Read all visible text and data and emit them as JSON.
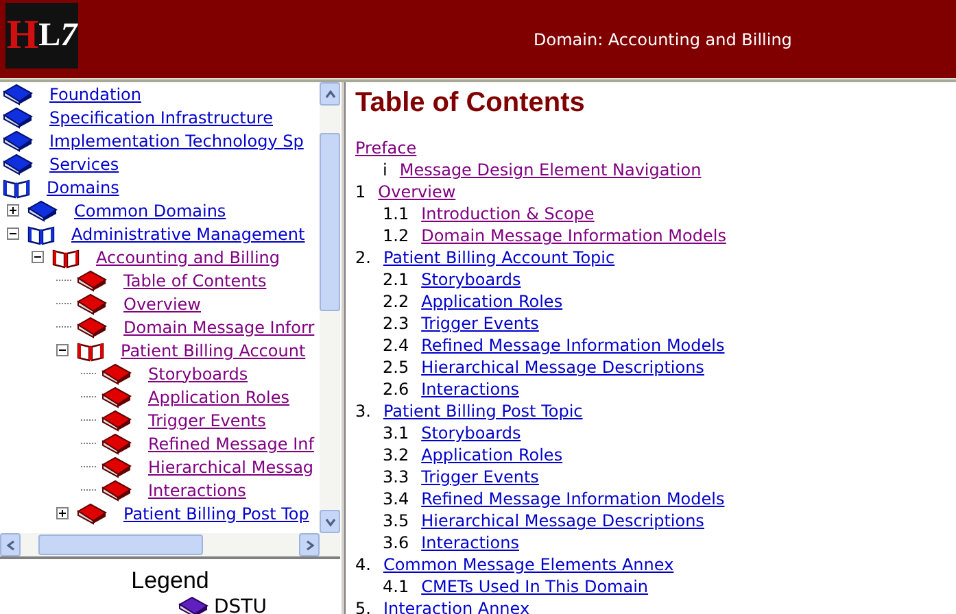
{
  "header": {
    "logo": "HL7",
    "title": "Domain: Accounting and Billing"
  },
  "tree": [
    {
      "label": "Foundation",
      "kind": "blue",
      "expanded": false,
      "visited": false
    },
    {
      "label": "Specification Infrastructure",
      "kind": "blue",
      "expanded": false,
      "visited": false
    },
    {
      "label": "Implementation Technology Sp",
      "kind": "blue",
      "expanded": false,
      "visited": false
    },
    {
      "label": "Services",
      "kind": "blue",
      "expanded": false,
      "visited": false
    },
    {
      "label": "Domains",
      "kind": "blue",
      "expanded": true,
      "visited": false,
      "children": [
        {
          "label": "Common Domains",
          "kind": "blue",
          "expanded": false,
          "visited": false
        },
        {
          "label": "Administrative Management",
          "kind": "blue",
          "expanded": true,
          "visited": false,
          "children": [
            {
              "label": "Accounting and Billing",
              "kind": "red",
              "expanded": true,
              "visited": true,
              "children": [
                {
                  "label": "Table of Contents",
                  "kind": "red",
                  "visited": true
                },
                {
                  "label": "Overview",
                  "kind": "red",
                  "visited": true
                },
                {
                  "label": "Domain Message Inforr",
                  "kind": "red",
                  "visited": true
                },
                {
                  "label": "Patient Billing Account",
                  "kind": "red",
                  "expanded": true,
                  "visited": true,
                  "children": [
                    {
                      "label": "Storyboards",
                      "kind": "red",
                      "visited": true
                    },
                    {
                      "label": "Application Roles",
                      "kind": "red",
                      "visited": true
                    },
                    {
                      "label": "Trigger Events",
                      "kind": "red",
                      "visited": true
                    },
                    {
                      "label": "Refined Message Inf",
                      "kind": "red",
                      "visited": true
                    },
                    {
                      "label": "Hierarchical Messag",
                      "kind": "red",
                      "visited": true
                    },
                    {
                      "label": "Interactions",
                      "kind": "red",
                      "visited": true
                    }
                  ]
                },
                {
                  "label": "Patient Billing Post Top",
                  "kind": "red",
                  "expanded": false,
                  "visited": false
                }
              ]
            }
          ]
        }
      ]
    }
  ],
  "legend": {
    "title": "Legend",
    "items": [
      {
        "label": "DSTU",
        "kind": "purple"
      }
    ]
  },
  "content": {
    "title": "Table of Contents",
    "sections": [
      {
        "label": "Preface",
        "visited": true,
        "children": [
          {
            "number": "i",
            "label": "Message Design Element Navigation",
            "visited": true
          }
        ]
      },
      {
        "number": "1",
        "label": "Overview",
        "visited": true,
        "children": [
          {
            "number": "1.1",
            "label": "Introduction & Scope",
            "visited": true
          },
          {
            "number": "1.2",
            "label": "Domain Message Information Models",
            "visited": true
          }
        ]
      },
      {
        "number": "2.",
        "label": "Patient Billing Account Topic",
        "visited": false,
        "children": [
          {
            "number": "2.1",
            "label": "Storyboards",
            "visited": false
          },
          {
            "number": "2.2",
            "label": "Application Roles",
            "visited": false
          },
          {
            "number": "2.3",
            "label": "Trigger Events",
            "visited": false
          },
          {
            "number": "2.4",
            "label": "Refined Message Information Models",
            "visited": false
          },
          {
            "number": "2.5",
            "label": "Hierarchical Message Descriptions",
            "visited": false
          },
          {
            "number": "2.6",
            "label": "Interactions",
            "visited": false
          }
        ]
      },
      {
        "number": "3.",
        "label": "Patient Billing Post Topic",
        "visited": false,
        "children": [
          {
            "number": "3.1",
            "label": "Storyboards",
            "visited": false
          },
          {
            "number": "3.2",
            "label": "Application Roles",
            "visited": false
          },
          {
            "number": "3.3",
            "label": "Trigger Events",
            "visited": false
          },
          {
            "number": "3.4",
            "label": "Refined Message Information Models",
            "visited": false
          },
          {
            "number": "3.5",
            "label": "Hierarchical Message Descriptions",
            "visited": false
          },
          {
            "number": "3.6",
            "label": "Interactions",
            "visited": false
          }
        ]
      },
      {
        "number": "4.",
        "label": "Common Message Elements Annex",
        "visited": false,
        "children": [
          {
            "number": "4.1",
            "label": "CMETs Used In This Domain",
            "visited": false
          }
        ]
      },
      {
        "number": "5.",
        "label": "Interaction Annex",
        "visited": false
      }
    ]
  }
}
